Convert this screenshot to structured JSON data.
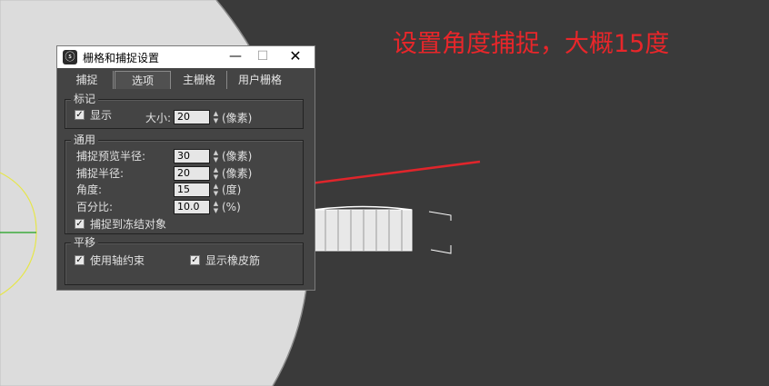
{
  "annotation": "设置角度捕捉，大概15度",
  "dialog": {
    "title": "栅格和捕捉设置",
    "window_buttons": {
      "minimize": "—",
      "maximize": "☐",
      "close": "✕"
    },
    "tabs": [
      {
        "label": "捕捉",
        "active": false
      },
      {
        "label": "选项",
        "active": true
      },
      {
        "label": "主栅格",
        "active": false
      },
      {
        "label": "用户栅格",
        "active": false
      }
    ],
    "marker_group": {
      "legend": "标记",
      "show_label": "显示",
      "show_checked": true,
      "size_label": "大小:",
      "size_value": "20",
      "size_unit": "(像素)"
    },
    "general_group": {
      "legend": "通用",
      "preview_radius_label": "捕捉预览半径:",
      "preview_radius_value": "30",
      "preview_radius_unit": "(像素)",
      "snap_radius_label": "捕捉半径:",
      "snap_radius_value": "20",
      "snap_radius_unit": "(像素)",
      "angle_label": "角度:",
      "angle_value": "15",
      "angle_unit": "(度)",
      "percent_label": "百分比:",
      "percent_value": "10.0",
      "percent_unit": "(%)",
      "snap_frozen_label": "捕捉到冻结对象",
      "snap_frozen_checked": true
    },
    "translate_group": {
      "legend": "平移",
      "use_axis_constraint_label": "使用轴约束",
      "use_axis_constraint_checked": true,
      "show_rubber_band_label": "显示橡皮筋",
      "show_rubber_band_checked": true
    }
  },
  "colors": {
    "annotation": "#e8262a",
    "arrow": "#e0252b",
    "viewport_bg": "#3a3a3a",
    "plane": "#dcdcdc"
  }
}
